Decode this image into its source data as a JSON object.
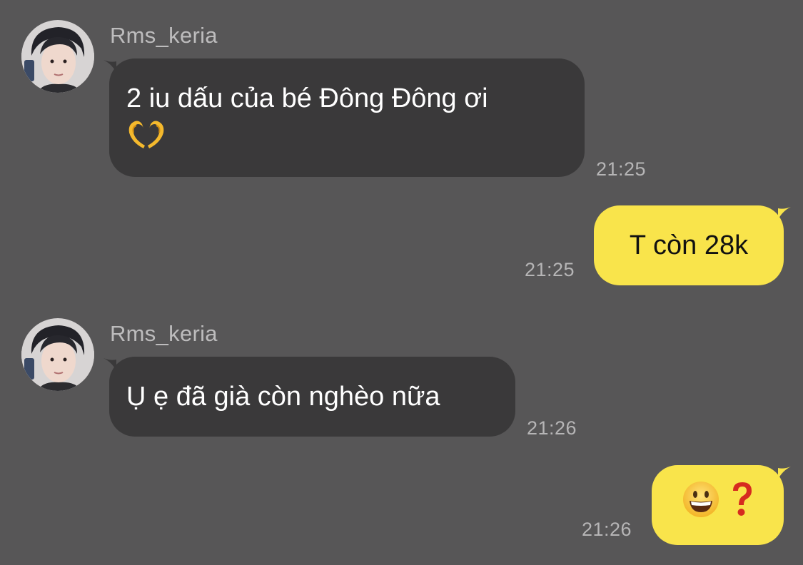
{
  "messages": [
    {
      "sender": "Rms_keria",
      "line1": "2 iu dấu của bé Đông Đông ơi",
      "line2_icon": "heart-hands-icon",
      "time": "21:25"
    },
    {
      "text": "T còn 28k",
      "time": "21:25"
    },
    {
      "sender": "Rms_keria",
      "text": "Ụ ẹ đã già còn nghèo nữa",
      "time": "21:26"
    },
    {
      "icons": [
        "grinning-face-icon",
        "red-question-mark-icon"
      ],
      "time": "21:26"
    }
  ],
  "colors": {
    "background": "#575657",
    "incoming_bubble": "#3a393a",
    "outgoing_bubble": "#f9e44b",
    "sender_name": "#bdbcbd",
    "timestamp": "#b6b5b6"
  }
}
